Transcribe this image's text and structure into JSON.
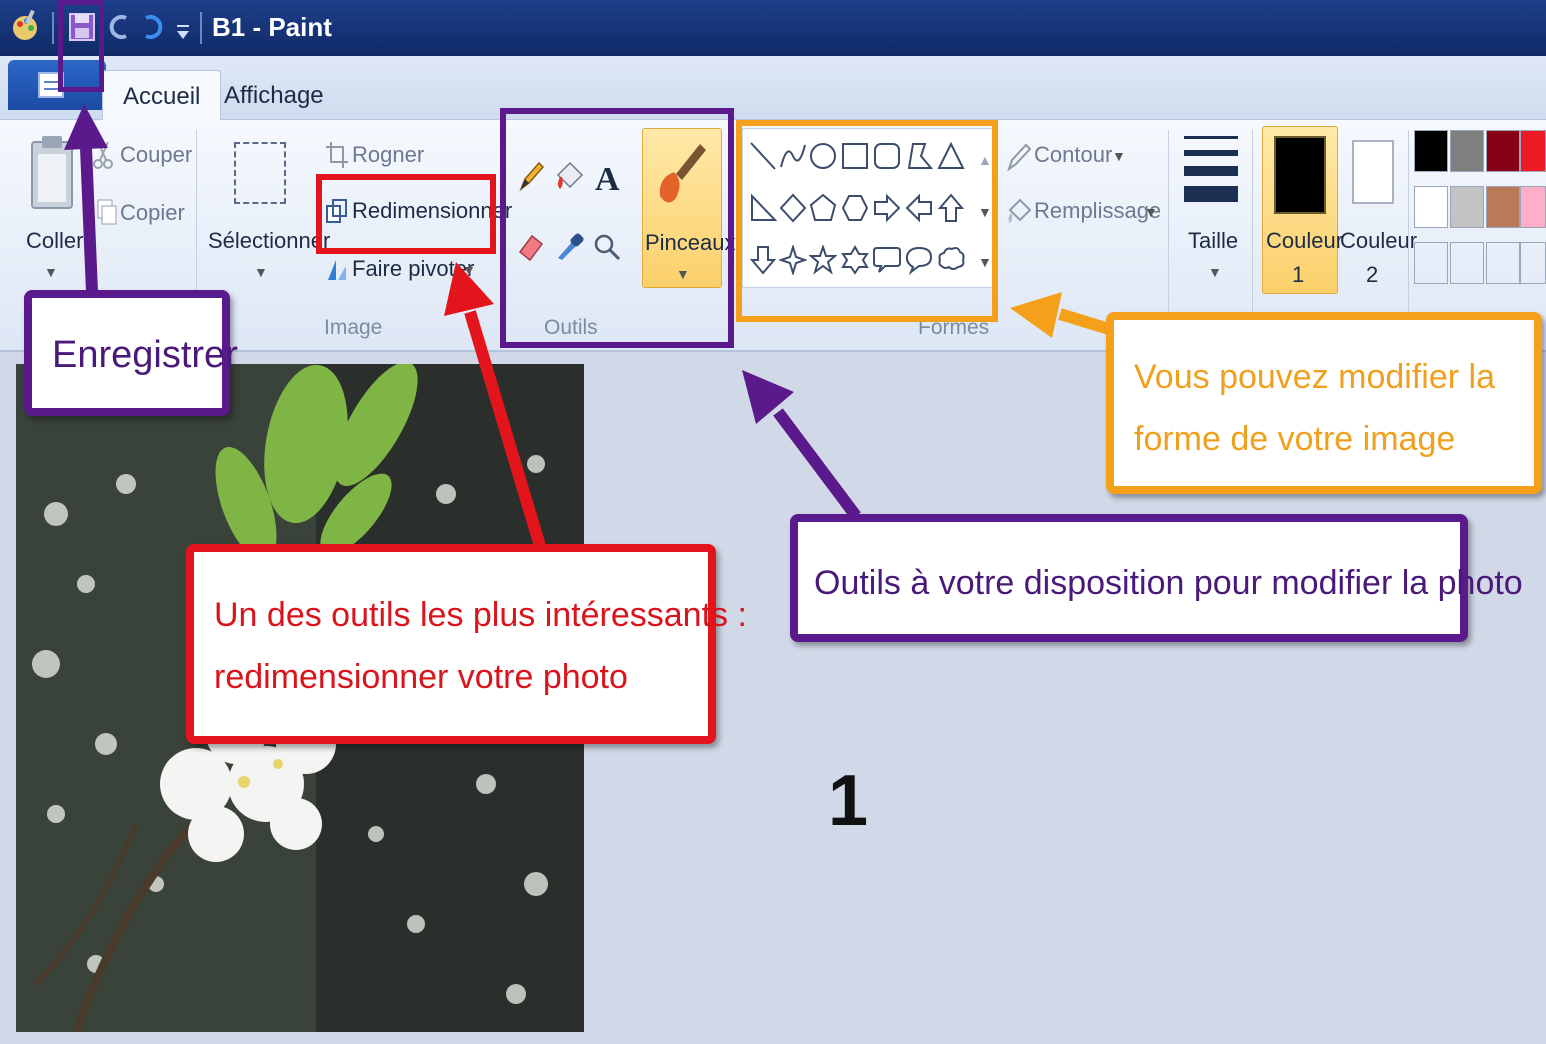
{
  "window": {
    "title": "B1 - Paint"
  },
  "tabs": [
    {
      "label": "Accueil"
    },
    {
      "label": "Affichage"
    }
  ],
  "ribbon": {
    "clipboard": {
      "paste": "Coller",
      "cut": "Couper",
      "copy": "Copier"
    },
    "image": {
      "select": "Sélectionner",
      "crop": "Rogner",
      "resize": "Redimensionner",
      "rotate": "Faire pivoter",
      "group": "Image"
    },
    "tools": {
      "group": "Outils"
    },
    "brushes": {
      "label": "Pinceaux"
    },
    "shapes": {
      "outline": "Contour",
      "fill": "Remplissage",
      "group": "Formes"
    },
    "size": {
      "label": "Taille"
    },
    "color1": {
      "line1": "Couleur",
      "line2": "1"
    },
    "color2": {
      "line1": "Couleur",
      "line2": "2"
    },
    "palette_row1": [
      "#000000",
      "#7f7f7f",
      "#880015",
      "#ed1c24"
    ],
    "palette_row2": [
      "#ffffff",
      "#c3c3c3",
      "#b97a57",
      "#ffaec9"
    ]
  },
  "annotations": {
    "save": "Enregistrer",
    "shape_hint_line1": "Vous pouvez modifier la",
    "shape_hint_line2": "forme de votre image",
    "tools_hint": "Outils à votre disposition pour modifier la photo",
    "resize_hint_line1": "Un des outils les plus intéressants :",
    "resize_hint_line2": "redimensionner votre photo",
    "number": "1"
  },
  "colors": {
    "purple": "#5b1a8c",
    "red": "#e3141b",
    "orange": "#f5a01a",
    "titlebar": "#14306f"
  }
}
